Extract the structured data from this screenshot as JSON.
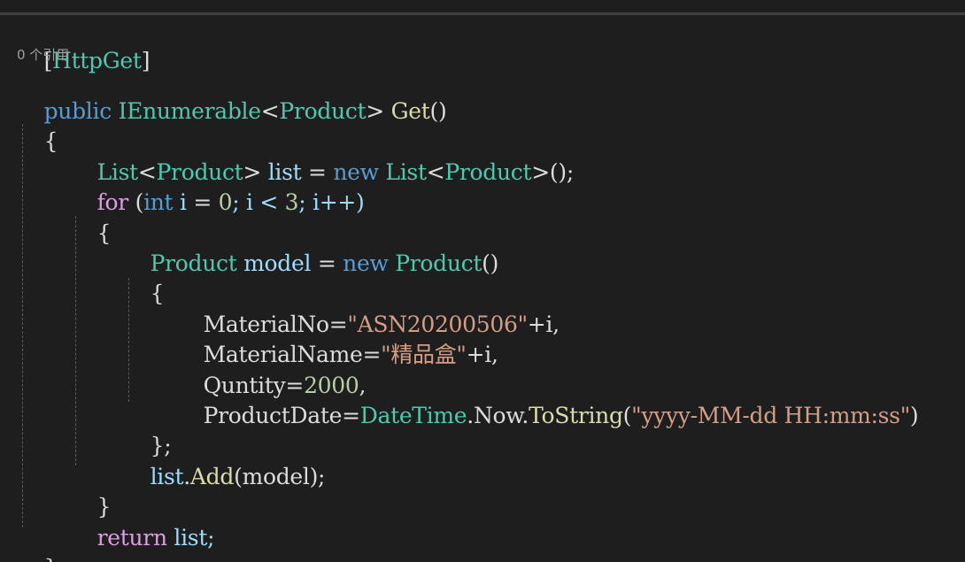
{
  "codelens": "0 个引用",
  "lines": {
    "l1": {
      "open": "[",
      "attr": "HttpGet",
      "close": "]"
    },
    "l2": {
      "kw": "public",
      "sp": " ",
      "type": "IEnumerable",
      "lt": "<",
      "gen": "Product",
      "gt": ">",
      "sp2": " ",
      "fn": "Get",
      "paren": "()"
    },
    "l3": {
      "brace": "{"
    },
    "l4": {
      "type": "List",
      "lt": "<",
      "gen": "Product",
      "gt": ">",
      "var": " list ",
      "eq": "=",
      "sp": " ",
      "kw": "new",
      "sp2": " ",
      "type2": "List",
      "lt2": "<",
      "gen2": "Product",
      "gt2": ">",
      "rest": "();"
    },
    "l5": {
      "ctl": "for",
      "sp": " (",
      "kw": "int",
      "var": " i ",
      "eq": "=",
      "sp2": " ",
      "num": "0",
      "mid": "; i < ",
      "num2": "3",
      "end": "; i++)"
    },
    "l6": {
      "brace": "{"
    },
    "l7": {
      "type": "Product",
      "var": " model ",
      "eq": "=",
      "sp": " ",
      "kw": "new",
      "sp2": " ",
      "type2": "Product",
      "rest": "()"
    },
    "l8": {
      "brace": "{"
    },
    "l9": {
      "prop": "MaterialNo",
      "eq": "=",
      "str": "\"ASN20200506\"",
      "rest": "+i,"
    },
    "l10": {
      "prop": "MaterialName",
      "eq": "=",
      "str": "\"精品盒\"",
      "rest": "+i,"
    },
    "l11": {
      "prop": "Quntity",
      "eq": "=",
      "num": "2000",
      "rest": ","
    },
    "l12": {
      "prop": "ProductDate",
      "eq": "=",
      "type": "DateTime",
      "dot": ".",
      "mem": "Now",
      "dot2": ".",
      "fn": "ToString",
      "open": "(",
      "str": "\"yyyy-MM-dd HH:mm:ss\"",
      "close": ")"
    },
    "l13": {
      "brace": "};"
    },
    "l14": {
      "var": "list",
      "dot": ".",
      "fn": "Add",
      "rest": "(model);"
    },
    "l15": {
      "brace": "}"
    },
    "l16": {
      "ctl": "return",
      "rest": " list;"
    },
    "l17": {
      "brace": "}"
    }
  }
}
